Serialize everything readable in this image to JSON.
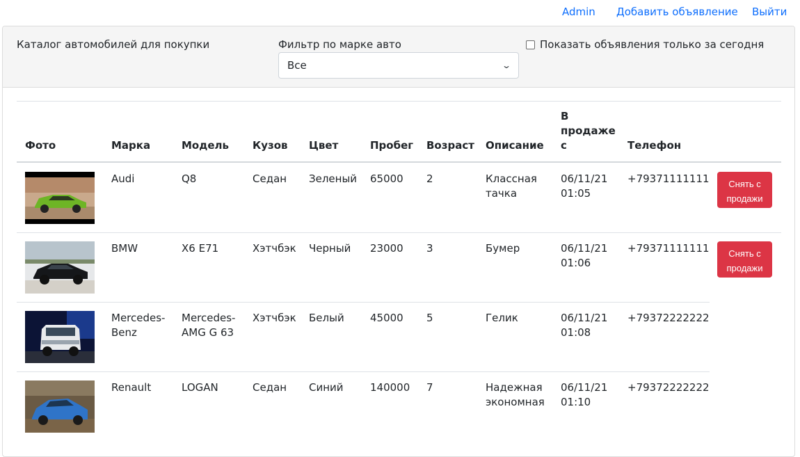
{
  "nav": {
    "user": "Admin",
    "add_listing": "Добавить объявление",
    "logout": "Выйти"
  },
  "header": {
    "catalog_title": "Каталог автомобилей для покупки",
    "filter_label": "Фильтр по марке авто",
    "filter_selected": "Все",
    "today_only_label": "Показать объявления только за сегодня",
    "today_only_checked": false
  },
  "table": {
    "columns": {
      "photo": "Фото",
      "brand": "Марка",
      "model": "Модель",
      "body": "Кузов",
      "color": "Цвет",
      "mileage": "Пробег",
      "age": "Возраст",
      "description": "Описание",
      "on_sale_since": "В продаже с",
      "phone": "Телефон"
    },
    "rows": [
      {
        "brand": "Audi",
        "model": "Q8",
        "body": "Седан",
        "color": "Зеленый",
        "mileage": "65000",
        "age": "2",
        "description": "Классная тачка",
        "date": "06/11/21",
        "time": "01:05",
        "phone": "+79371111111",
        "action": "Снять с продажи",
        "photo_icon": "green-suv-photo"
      },
      {
        "brand": "BMW",
        "model": "X6 E71",
        "body": "Хэтчбэк",
        "color": "Черный",
        "mileage": "23000",
        "age": "3",
        "description": "Бумер",
        "date": "06/11/21",
        "time": "01:06",
        "phone": "+79371111111",
        "action": "Снять с продажи",
        "photo_icon": "black-suv-photo"
      },
      {
        "brand": "Mercedes-Benz",
        "model": "Mercedes-AMG G 63",
        "body": "Хэтчбэк",
        "color": "Белый",
        "mileage": "45000",
        "age": "5",
        "description": "Гелик",
        "date": "06/11/21",
        "time": "01:08",
        "phone": "+79372222222",
        "action": "",
        "photo_icon": "white-suv-photo"
      },
      {
        "brand": "Renault",
        "model": "LOGAN",
        "body": "Седан",
        "color": "Синий",
        "mileage": "140000",
        "age": "7",
        "description": "Надежная экономная",
        "date": "06/11/21",
        "time": "01:10",
        "phone": "+79372222222",
        "action": "",
        "photo_icon": "blue-sedan-photo"
      }
    ]
  },
  "colors": {
    "link": "#0d6efd",
    "danger": "#dc3545",
    "header_bg": "#f5f5f5"
  }
}
